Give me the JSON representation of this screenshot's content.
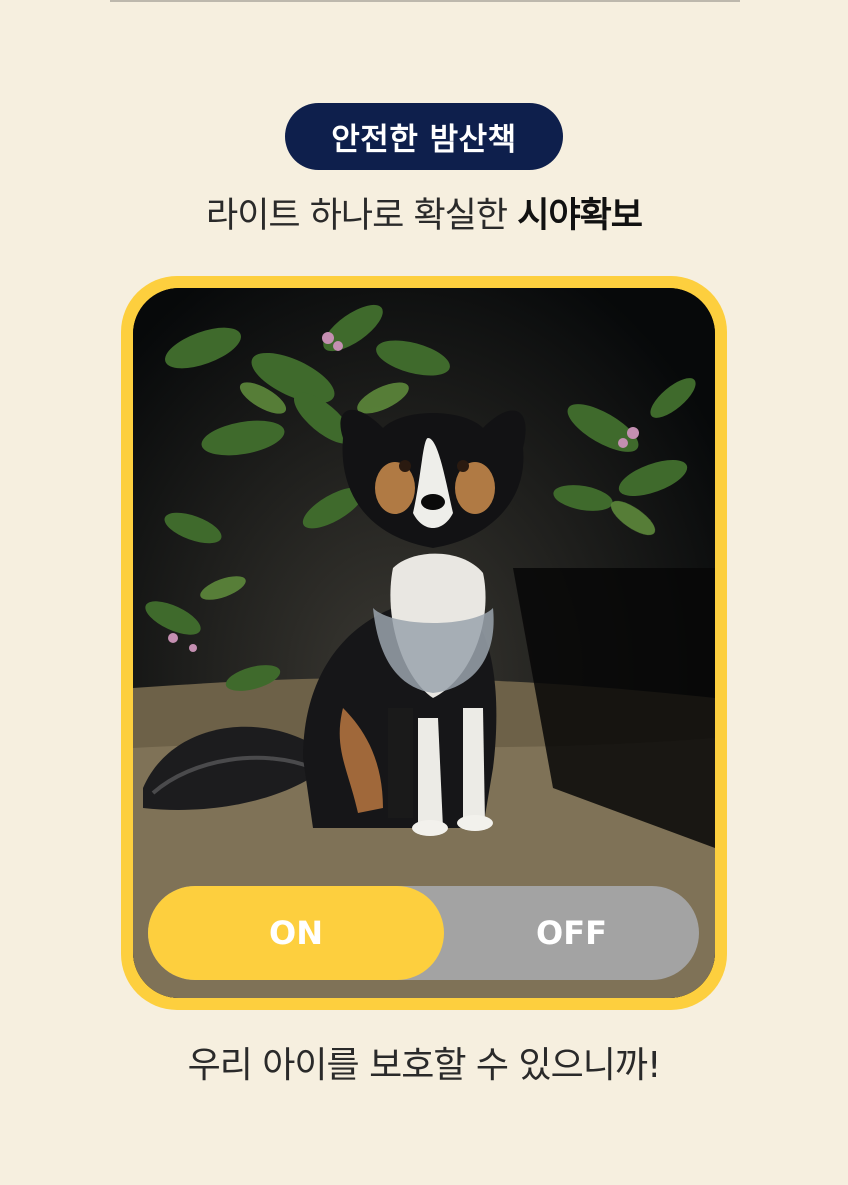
{
  "badge": {
    "label": "안전한 밤산책"
  },
  "subtitle": {
    "normal": "라이트 하나로 확실한 ",
    "bold": "시야확보"
  },
  "photo": {
    "subject": "dog-at-night-photo"
  },
  "toggle": {
    "on_label": "ON",
    "off_label": "OFF",
    "selected": "ON",
    "on_color": "#fdcf3e",
    "off_color": "#a3a3a3"
  },
  "caption": {
    "text": "우리 아이를 보호할 수 있으니까!"
  },
  "colors": {
    "background": "#f6efdf",
    "badge_bg": "#0e1f4c",
    "frame": "#fdcf3e"
  }
}
